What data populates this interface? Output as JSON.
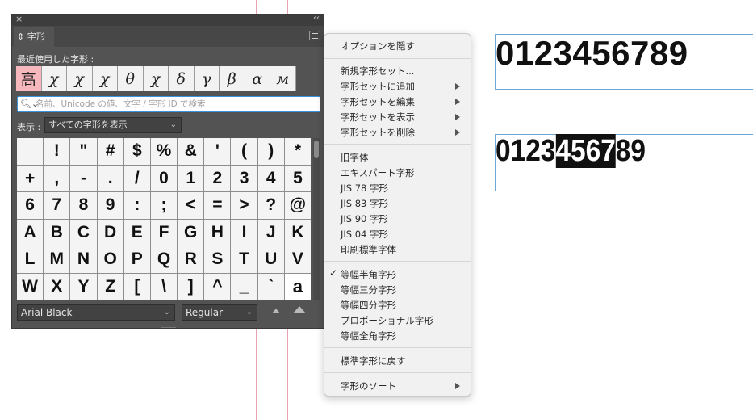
{
  "panel": {
    "title": "字形",
    "recent_label": "最近使用した字形 :",
    "recent_glyphs": [
      "高",
      "χ",
      "χ",
      "χ",
      "θ",
      "χ",
      "δ",
      "γ",
      "β",
      "α",
      "м"
    ],
    "search_placeholder": "名前、Unicode の値、文字 / 字形 ID で検索",
    "show_label": "表示 :",
    "show_value": "すべての字形を表示",
    "glyph_rows": [
      [
        "",
        "!",
        "\"",
        "#",
        "$",
        "%",
        "&",
        "'",
        "(",
        ")",
        "*"
      ],
      [
        "+",
        ",",
        "-",
        ".",
        "/",
        "0",
        "1",
        "2",
        "3",
        "4",
        "5"
      ],
      [
        "6",
        "7",
        "8",
        "9",
        ":",
        ";",
        "<",
        "=",
        ">",
        "?",
        "@"
      ],
      [
        "A",
        "B",
        "C",
        "D",
        "E",
        "F",
        "G",
        "H",
        "I",
        "J",
        "K"
      ],
      [
        "L",
        "M",
        "N",
        "O",
        "P",
        "Q",
        "R",
        "S",
        "T",
        "U",
        "V"
      ],
      [
        "W",
        "X",
        "Y",
        "Z",
        "[",
        "\\",
        "]",
        "^",
        "_",
        "`",
        "a"
      ]
    ],
    "font_family": "Arial Black",
    "font_style": "Regular"
  },
  "menu": {
    "hide_options": "オプションを隠す",
    "new_set": "新規字形セット...",
    "add_to_set": "字形セットに追加",
    "edit_set": "字形セットを編集",
    "view_set": "字形セットを表示",
    "delete_set": "字形セットを削除",
    "old_form": "旧字体",
    "expert": "エキスパート字形",
    "jis78": "JIS 78 字形",
    "jis83": "JIS 83 字形",
    "jis90": "JIS 90 字形",
    "jis04": "JIS 04 字形",
    "print_standard": "印刷標準字体",
    "half_width": "等幅半角字形",
    "third_width": "等幅三分字形",
    "quarter_width": "等幅四分字形",
    "proportional": "プロポーショナル字形",
    "full_width": "等幅全角字形",
    "revert": "標準字形に戻す",
    "sort": "字形のソート"
  },
  "canvas": {
    "text1": "0123456789",
    "text2_before": "0123",
    "text2_selected": "4567",
    "text2_after": "89"
  }
}
